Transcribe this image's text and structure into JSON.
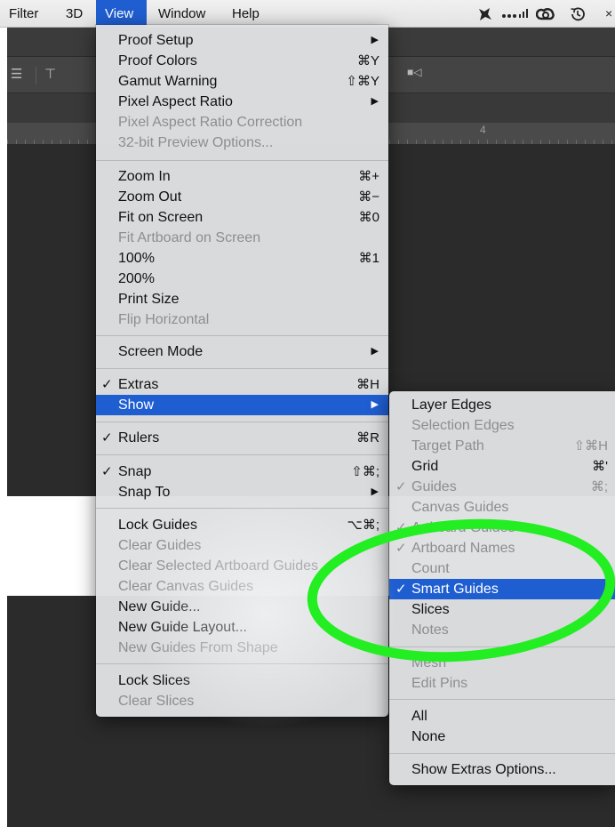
{
  "menubar": {
    "items": [
      {
        "label": "Filter"
      },
      {
        "label": "3D"
      },
      {
        "label": "View"
      },
      {
        "label": "Window"
      },
      {
        "label": "Help"
      }
    ]
  },
  "ruler": {
    "visible_number": "4"
  },
  "view_menu": {
    "items": [
      {
        "label": "Proof Setup",
        "shortcut": "",
        "submenu": true,
        "enabled": true,
        "checked": false
      },
      {
        "label": "Proof Colors",
        "shortcut": "⌘Y",
        "enabled": true
      },
      {
        "label": "Gamut Warning",
        "shortcut": "⇧⌘Y",
        "enabled": true
      },
      {
        "label": "Pixel Aspect Ratio",
        "submenu": true,
        "enabled": true
      },
      {
        "label": "Pixel Aspect Ratio Correction",
        "enabled": false
      },
      {
        "label": "32-bit Preview Options...",
        "enabled": false
      },
      {
        "label": "Zoom In",
        "shortcut": "⌘+",
        "enabled": true
      },
      {
        "label": "Zoom Out",
        "shortcut": "⌘−",
        "enabled": true
      },
      {
        "label": "Fit on Screen",
        "shortcut": "⌘0",
        "enabled": true
      },
      {
        "label": "Fit Artboard on Screen",
        "enabled": false
      },
      {
        "label": "100%",
        "shortcut": "⌘1",
        "enabled": true
      },
      {
        "label": "200%",
        "enabled": true
      },
      {
        "label": "Print Size",
        "enabled": true
      },
      {
        "label": "Flip Horizontal",
        "enabled": false
      },
      {
        "label": "Screen Mode",
        "submenu": true,
        "enabled": true
      },
      {
        "label": "Extras",
        "shortcut": "⌘H",
        "enabled": true,
        "checked": true
      },
      {
        "label": "Show",
        "submenu": true,
        "enabled": true,
        "highlighted": true
      },
      {
        "label": "Rulers",
        "shortcut": "⌘R",
        "enabled": true,
        "checked": true
      },
      {
        "label": "Snap",
        "shortcut": "⇧⌘;",
        "enabled": true,
        "checked": true
      },
      {
        "label": "Snap To",
        "submenu": true,
        "enabled": true
      },
      {
        "label": "Lock Guides",
        "shortcut": "⌥⌘;",
        "enabled": true
      },
      {
        "label": "Clear Guides",
        "enabled": false
      },
      {
        "label": "Clear Selected Artboard Guides",
        "enabled": false
      },
      {
        "label": "Clear Canvas Guides",
        "enabled": false
      },
      {
        "label": "New Guide...",
        "enabled": true
      },
      {
        "label": "New Guide Layout...",
        "enabled": true
      },
      {
        "label": "New Guides From Shape",
        "enabled": false
      },
      {
        "label": "Lock Slices",
        "enabled": true
      },
      {
        "label": "Clear Slices",
        "enabled": false
      }
    ]
  },
  "show_menu": {
    "items": [
      {
        "label": "Layer Edges",
        "enabled": true
      },
      {
        "label": "Selection Edges",
        "enabled": false
      },
      {
        "label": "Target Path",
        "shortcut": "⇧⌘H",
        "enabled": false
      },
      {
        "label": "Grid",
        "shortcut": "⌘'",
        "enabled": true
      },
      {
        "label": "Guides",
        "shortcut": "⌘;",
        "enabled": false,
        "checked": true
      },
      {
        "label": "Canvas Guides",
        "enabled": false
      },
      {
        "label": "Artboard Guides",
        "enabled": false,
        "checked": true
      },
      {
        "label": "Artboard Names",
        "enabled": false,
        "checked": true
      },
      {
        "label": "Count",
        "enabled": false
      },
      {
        "label": "Smart Guides",
        "enabled": true,
        "checked": true,
        "highlighted": true
      },
      {
        "label": "Slices",
        "enabled": true
      },
      {
        "label": "Notes",
        "enabled": false
      },
      {
        "label": "Mesh",
        "enabled": false
      },
      {
        "label": "Edit Pins",
        "enabled": false
      },
      {
        "label": "All",
        "enabled": true
      },
      {
        "label": "None",
        "enabled": true
      },
      {
        "label": "Show Extras Options...",
        "enabled": true
      }
    ]
  },
  "colors": {
    "highlight": "#1f5ed1",
    "annotation": "#22ee22",
    "menu_bg": "#dedfe1",
    "disabled_text": "#8c8e91"
  },
  "icons": {
    "checkmark": "checkmark-icon",
    "submenu": "submenu-arrow-icon"
  }
}
